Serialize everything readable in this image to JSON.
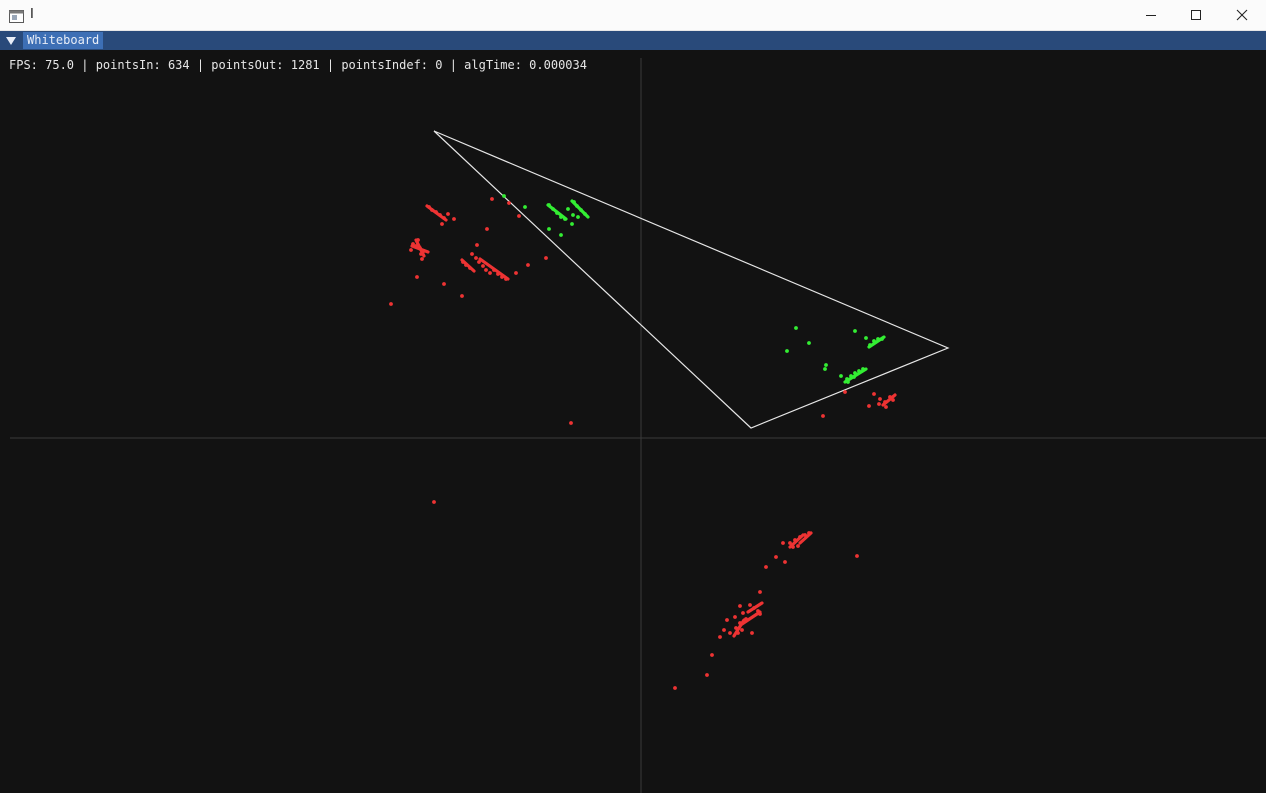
{
  "window": {
    "title": "I",
    "menu_tab": "Whiteboard"
  },
  "stats": {
    "line": "FPS: 75.0 | pointsIn: 634 | pointsOut: 1281 | pointsIndef: 0 | algTime: 0.000034"
  },
  "colors": {
    "point_in": "#33ee33",
    "point_out": "#ee3333",
    "triangle": "#e6e6e6",
    "axis": "#3a3a3a",
    "background": "#121212"
  },
  "icons": {
    "app": "app-window-icon",
    "menu_toggle": "triangle-down-icon",
    "minimize": "minimize-icon",
    "maximize": "maximize-icon",
    "close": "close-icon"
  }
}
